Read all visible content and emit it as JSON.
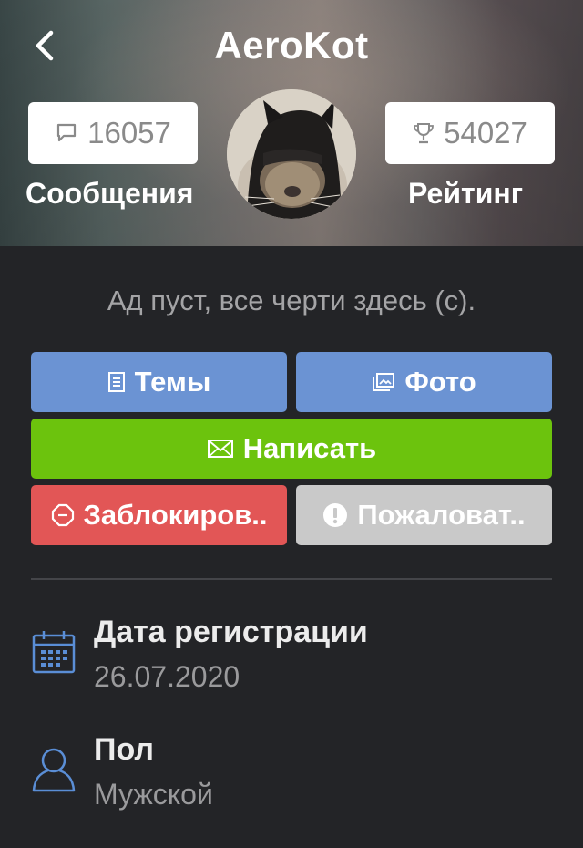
{
  "profile": {
    "username": "AeroKot",
    "messages_count": "16057",
    "messages_label": "Сообщения",
    "rating_count": "54027",
    "rating_label": "Рейтинг",
    "status_text": "Ад пуст, все черти здесь (с)."
  },
  "actions": {
    "topics_label": "Темы",
    "photos_label": "Фото",
    "write_label": "Написать",
    "block_label": "Заблокиров..",
    "report_label": "Пожаловат.."
  },
  "info": {
    "registration_label": "Дата регистрации",
    "registration_value": "26.07.2020",
    "gender_label": "Пол",
    "gender_value": "Мужской"
  },
  "colors": {
    "background": "#232427",
    "button_blue": "#6b93d3",
    "button_green": "#6cc30d",
    "button_red": "#e25656",
    "button_gray": "#c9c9c9",
    "info_icon": "#5a8ed6"
  },
  "icons": [
    "back-arrow-icon",
    "comment-icon",
    "trophy-icon",
    "document-icon",
    "image-icon",
    "envelope-icon",
    "stop-icon",
    "exclamation-icon",
    "calendar-icon",
    "user-icon"
  ]
}
